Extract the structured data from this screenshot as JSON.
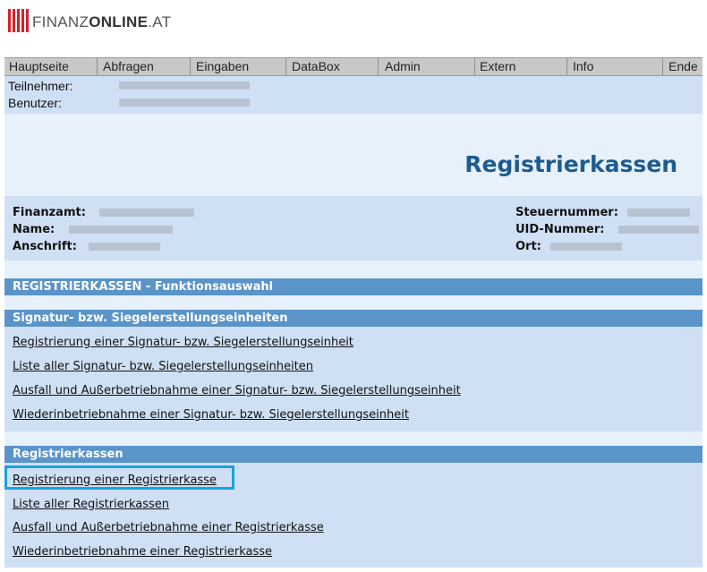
{
  "logo": {
    "text_light": "FINANZ",
    "text_bold": "ONLINE",
    "text_suffix": ".AT"
  },
  "menu": [
    "Hauptseite",
    "Abfragen",
    "Eingaben",
    "DataBox",
    "Admin",
    "Extern",
    "Info",
    "Ende"
  ],
  "user": {
    "teilnehmer_label": "Teilnehmer:",
    "benutzer_label": "Benutzer:"
  },
  "title": "Registrierkassen",
  "details": {
    "finanzamt": "Finanzamt:",
    "name": "Name:",
    "anschrift": "Anschrift:",
    "steuernummer": "Steuernummer:",
    "uid": "UID-Nummer:",
    "ort": "Ort:"
  },
  "sections": {
    "funktion": "REGISTRIERKASSEN - Funktionsauswahl",
    "signatur": "Signatur- bzw. Siegelerstellungseinheiten",
    "kassen": "Registrierkassen"
  },
  "signatur_links": [
    "Registrierung einer Signatur- bzw. Siegelerstellungseinheit",
    "Liste aller Signatur- bzw. Siegelerstellungseinheiten",
    "Ausfall und Außerbetriebnahme einer Signatur- bzw. Siegelerstellungseinheit",
    "Wiederinbetriebnahme einer Signatur- bzw. Siegelerstellungseinheit"
  ],
  "kassen_links": [
    "Registrierung einer Registrierkasse",
    "Liste aller Registrierkassen",
    "Ausfall und Außerbetriebnahme einer Registrierkasse",
    "Wiederinbetriebnahme einer Registrierkasse"
  ],
  "colors": {
    "brand_red": "#d3202a",
    "section_blue": "#5a94c8",
    "title_blue": "#1d5b90",
    "highlight": "#1aa3dc"
  }
}
